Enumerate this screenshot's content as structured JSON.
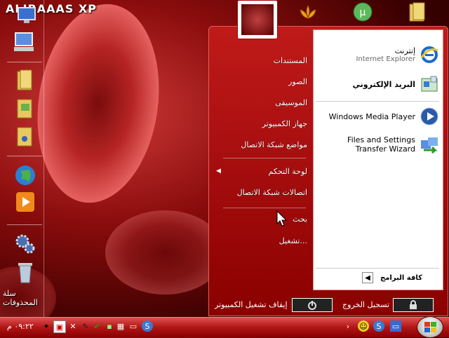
{
  "desktop": {
    "title": "ALIBAAAS XP",
    "trash_label": "سلة المحذوفات"
  },
  "start_menu": {
    "pinned": [
      {
        "title": "إنترنت",
        "subtitle": "Internet Explorer",
        "icon": "ie-icon"
      },
      {
        "title": "البريد الإلكتروني",
        "subtitle": "",
        "icon": "mail-icon"
      }
    ],
    "recent": [
      {
        "title": "Windows Media Player",
        "icon": "media-player-icon"
      },
      {
        "title": "Files and Settings Transfer Wizard",
        "icon": "transfer-wizard-icon"
      }
    ],
    "all_programs": "كافة البرامج",
    "places": [
      "المستندات",
      "الصور",
      "الموسيقى",
      "جهاز الكمبيوتر",
      "مواضع شبكة الاتصال"
    ],
    "system": [
      "لوحة التحكم",
      "اتصالات شبكة الاتصال"
    ],
    "actions": [
      "بحث",
      "تشغيل..."
    ],
    "logoff_label": "تسجيل الخروج",
    "shutdown_label": "إيقاف تشغيل الكمبيوتر"
  },
  "taskbar": {
    "clock": "٠٩:٢٢ م"
  },
  "colors": {
    "accent": "#b01515",
    "menu_bg": "#a00c0c",
    "pane_bg": "#ffffff"
  }
}
